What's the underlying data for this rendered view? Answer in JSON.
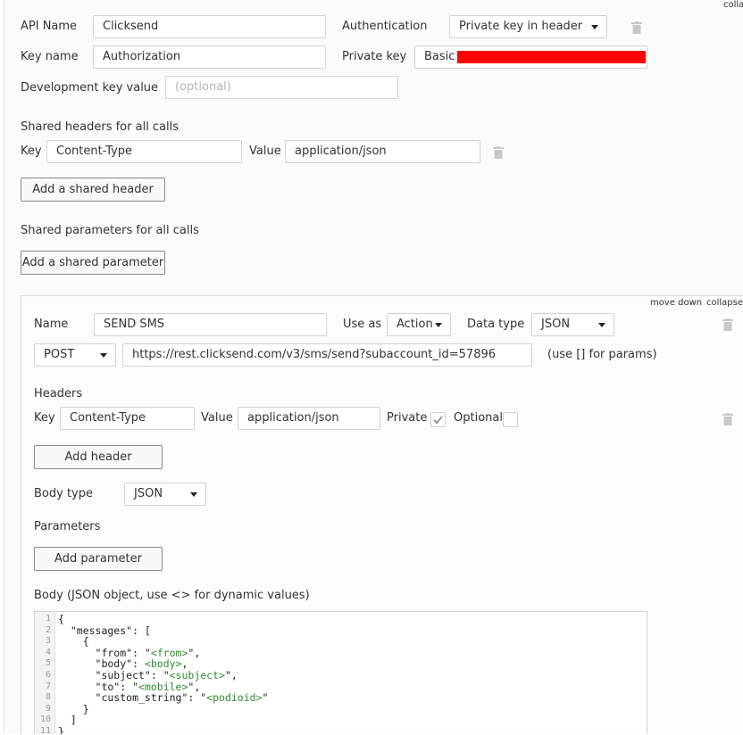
{
  "top_right_link": "colla",
  "api": {
    "name_label": "API Name",
    "name_value": "Clicksend",
    "auth_label": "Authentication",
    "auth_value": "Private key in header",
    "key_name_label": "Key name",
    "key_name_value": "Authorization",
    "private_key_label": "Private key",
    "private_key_value": "Basic Y",
    "dev_key_label": "Development key value",
    "dev_key_placeholder": "(optional)"
  },
  "shared_headers": {
    "title": "Shared headers for all calls",
    "key_label": "Key",
    "key_value": "Content-Type",
    "value_label": "Value",
    "value_value": "application/json",
    "add_button": "Add a shared header"
  },
  "shared_params": {
    "title": "Shared parameters for all calls",
    "add_button": "Add a shared parameter"
  },
  "call": {
    "move_down": "move down",
    "collapse": "collapse",
    "name_label": "Name",
    "name_value": "SEND SMS",
    "use_as_label": "Use as",
    "use_as_value": "Action",
    "data_type_label": "Data type",
    "data_type_value": "JSON",
    "method": "POST",
    "url": "https://rest.clicksend.com/v3/sms/send?subaccount_id=57896",
    "url_hint": "(use [] for params)",
    "headers_title": "Headers",
    "header_key_label": "Key",
    "header_key_value": "Content-Type",
    "header_value_label": "Value",
    "header_value_value": "application/json",
    "private_label": "Private",
    "private_checked": true,
    "optional_label": "Optional",
    "optional_checked": false,
    "add_header_button": "Add header",
    "body_type_label": "Body type",
    "body_type_value": "JSON",
    "parameters_title": "Parameters",
    "add_parameter_button": "Add parameter",
    "body_title": "Body (JSON object, use <> for dynamic values)"
  },
  "colors": {
    "redaction": "#ff0000",
    "dynamic_value": "#2e8b2e"
  },
  "body_code": {
    "line_numbers": [
      "1",
      "2",
      "3",
      "4",
      "5",
      "6",
      "7",
      "8",
      "9",
      "10",
      "11"
    ],
    "l1": "{",
    "l2": "  \"messages\": [",
    "l3": "    {",
    "l4_key": "      \"from\": \"",
    "l4_dyn": "<from>",
    "l4_end": "\",",
    "l5_key": "      \"body\": ",
    "l5_dyn": "<body>",
    "l5_end": ",",
    "l6_key": "      \"subject\": \"",
    "l6_dyn": "<subject>",
    "l6_end": "\",",
    "l7_key": "      \"to\": \"",
    "l7_dyn": "<mobile>",
    "l7_end": "\",",
    "l8_key": "      \"custom_string\": \"",
    "l8_dyn": "<podioid>",
    "l8_end": "\"",
    "l9": "    }",
    "l10": "  ]",
    "l11": "}"
  }
}
